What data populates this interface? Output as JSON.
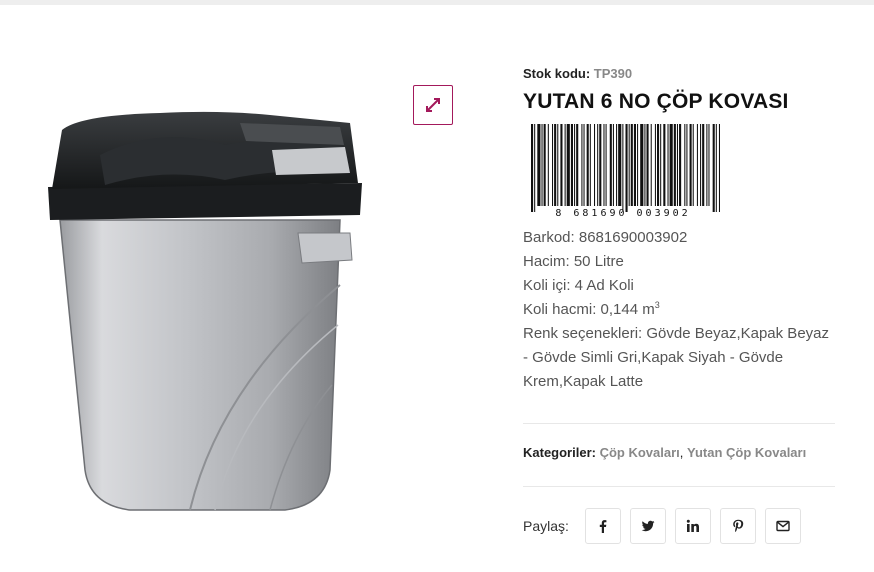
{
  "sku": {
    "label": "Stok kodu:",
    "value": "TP390"
  },
  "title": "YUTAN 6 NO ÇÖP KOVASI",
  "barcode_digits": "8 681690 003902",
  "attributes": {
    "barkod": "Barkod: 8681690003902",
    "hacim": "Hacim: 50 Litre",
    "koli_ici": "Koli içi: 4 Ad Koli",
    "koli_hacmi": "Koli hacmi: 0,144 m",
    "koli_hacmi_unit_sup": "3",
    "renk": "Renk seçenekleri: Gövde Beyaz,Kapak Beyaz - Gövde Simli Gri,Kapak Siyah - Gövde Krem,Kapak Latte"
  },
  "categories": {
    "label": "Kategoriler:",
    "items": [
      "Çöp Kovaları",
      "Yutan Çöp Kovaları"
    ],
    "separator": ", "
  },
  "share": {
    "label": "Paylaş:",
    "buttons": [
      "facebook-icon",
      "twitter-icon",
      "linkedin-icon",
      "pinterest-icon",
      "email-icon"
    ]
  },
  "colors": {
    "accent": "#a3195b",
    "muted_link": "#888888",
    "body_text": "#555555"
  }
}
